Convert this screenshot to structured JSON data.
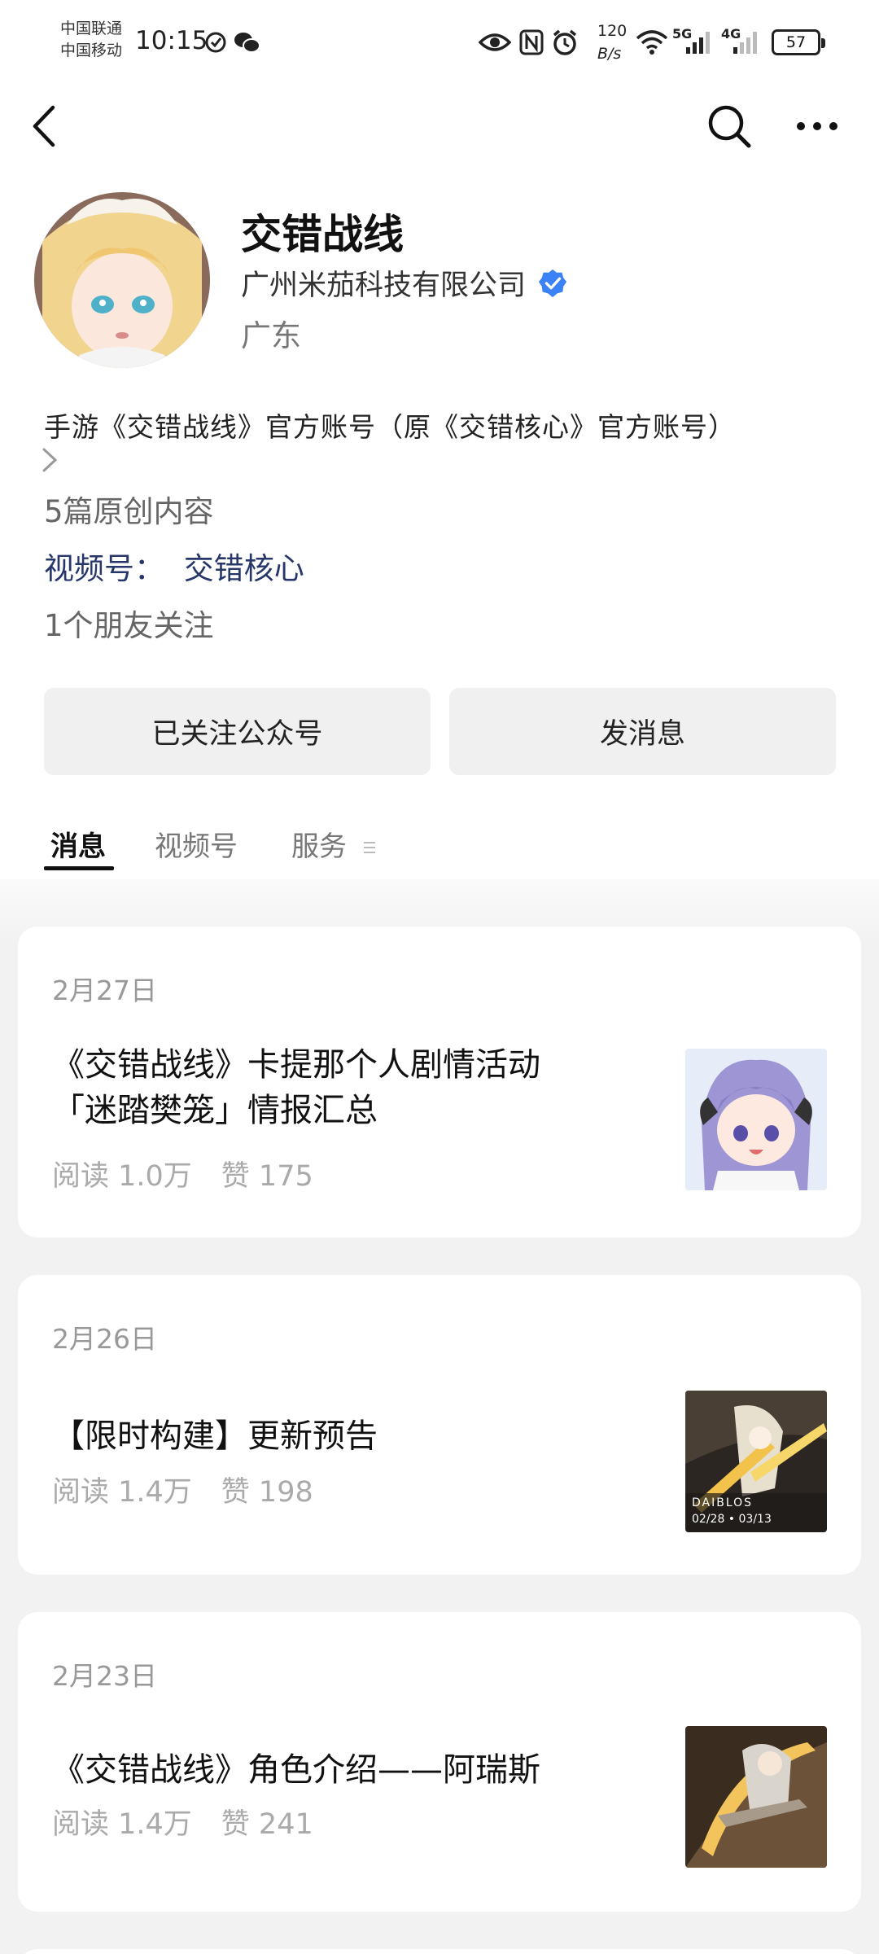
{
  "status_bar": {
    "carrier_1": "中国联通",
    "carrier_2": "中国移动",
    "time": "10:15",
    "net_speed_value": "120",
    "net_speed_unit": "B/s",
    "signal_1_label": "5G",
    "signal_2_label": "4G",
    "battery_level": "57"
  },
  "navbar": {
    "back_icon": "chevron-left",
    "search_icon": "search",
    "more_icon": "more-dots"
  },
  "profile": {
    "name": "交错战线",
    "company": "广州米茄科技有限公司",
    "region": "广东",
    "description": "手游《交错战线》官方账号（原《交错核心》官方账号）",
    "original_count": "5篇原创内容",
    "channel_label": "视频号：",
    "channel_name": "交错核心",
    "friends_following": "1个朋友关注"
  },
  "actions": {
    "followed_label": "已关注公众号",
    "message_label": "发消息"
  },
  "tabs": [
    {
      "label": "消息",
      "active": true
    },
    {
      "label": "视频号",
      "active": false
    },
    {
      "label": "服务",
      "active": false
    }
  ],
  "articles": [
    {
      "date": "2月27日",
      "title_line1": "《交错战线》卡提那个人剧情活动",
      "title_line2": "「迷踏樊笼」情报汇总",
      "reads": "阅读 1.0万",
      "likes": "赞 175"
    },
    {
      "date": "2月26日",
      "title_line1": "【限时构建】更新预告",
      "reads": "阅读 1.4万",
      "likes": "赞 198",
      "thumb_caption_1": "DAIBLOS",
      "thumb_caption_2": "02/28 • 03/13"
    },
    {
      "date": "2月23日",
      "title_line1": "《交错战线》角色介绍——阿瑞斯",
      "reads": "阅读 1.4万",
      "likes": "赞 241"
    }
  ],
  "colors": {
    "verified_blue": "#3b82f6",
    "link_navy": "#27366b",
    "button_gray": "#f0f0f0",
    "feed_background": "#f2f2f2"
  }
}
